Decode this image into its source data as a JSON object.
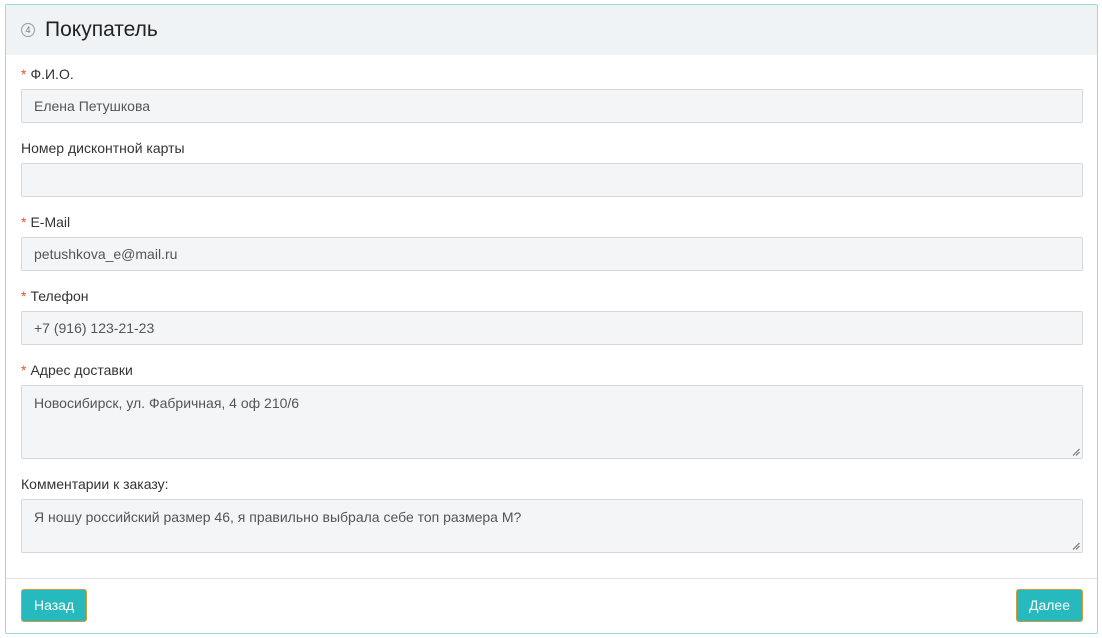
{
  "section": {
    "step_number": "4",
    "title": "Покупатель"
  },
  "form": {
    "required_mark": "*",
    "fio": {
      "label": "Ф.И.О.",
      "value": "Елена Петушкова"
    },
    "discount_card": {
      "label": "Номер дисконтной карты",
      "value": ""
    },
    "email": {
      "label": "E-Mail",
      "value": "petushkova_e@mail.ru"
    },
    "phone": {
      "label": "Телефон",
      "value": "+7 (916) 123-21-23"
    },
    "address": {
      "label": "Адрес доставки",
      "value": "Новосибирск, ул. Фабричная, 4 оф 210/6"
    },
    "comment": {
      "label": "Комментарии к заказу:",
      "value": "Я ношу российский размер 46, я правильно выбрала себе топ размера М?"
    }
  },
  "footer": {
    "back_label": "Назад",
    "next_label": "Далее"
  },
  "colors": {
    "accent": "#26b9bd",
    "required": "#e0542f",
    "button_border": "#d39a3a"
  }
}
